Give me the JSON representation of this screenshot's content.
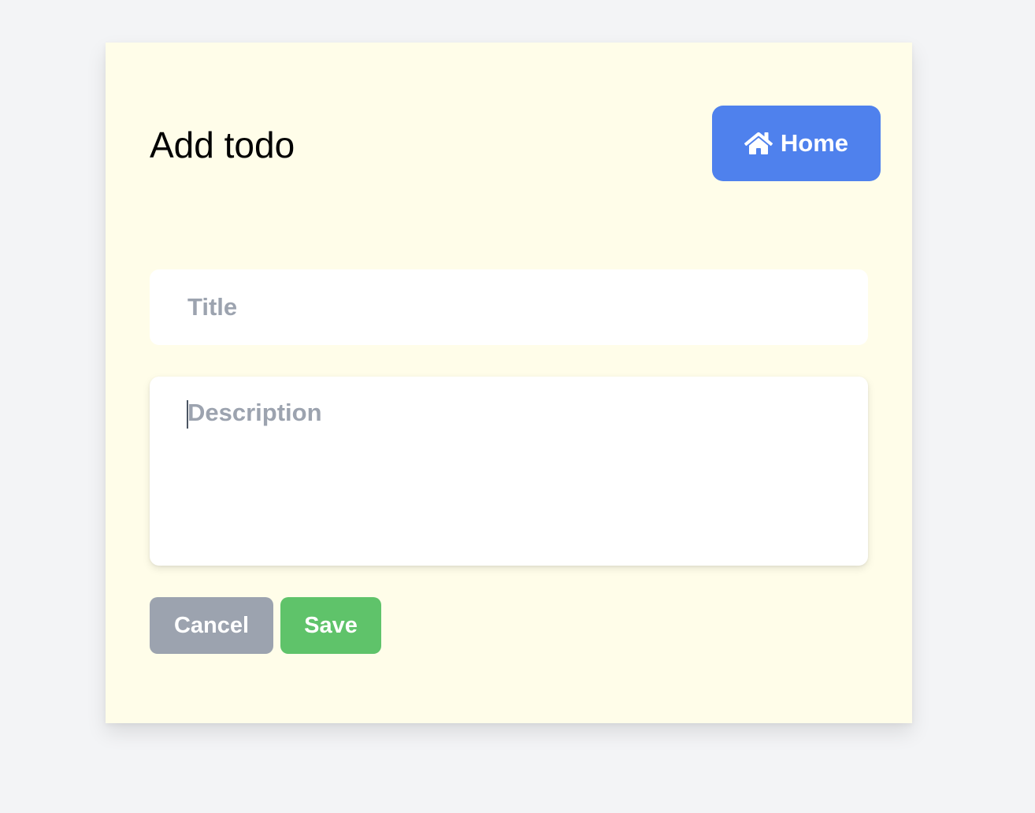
{
  "page": {
    "title": "Add todo"
  },
  "header": {
    "home_label": "Home",
    "home_icon": "home-icon"
  },
  "form": {
    "title_placeholder": "Title",
    "title_value": "",
    "description_placeholder": "Description",
    "description_value": ""
  },
  "actions": {
    "cancel_label": "Cancel",
    "save_label": "Save"
  },
  "colors": {
    "background": "#f3f4f6",
    "card": "#fffde9",
    "home_button": "#4f81ed",
    "cancel_button": "#9ca3af",
    "save_button": "#5fc36a",
    "placeholder": "#9ca3af"
  }
}
